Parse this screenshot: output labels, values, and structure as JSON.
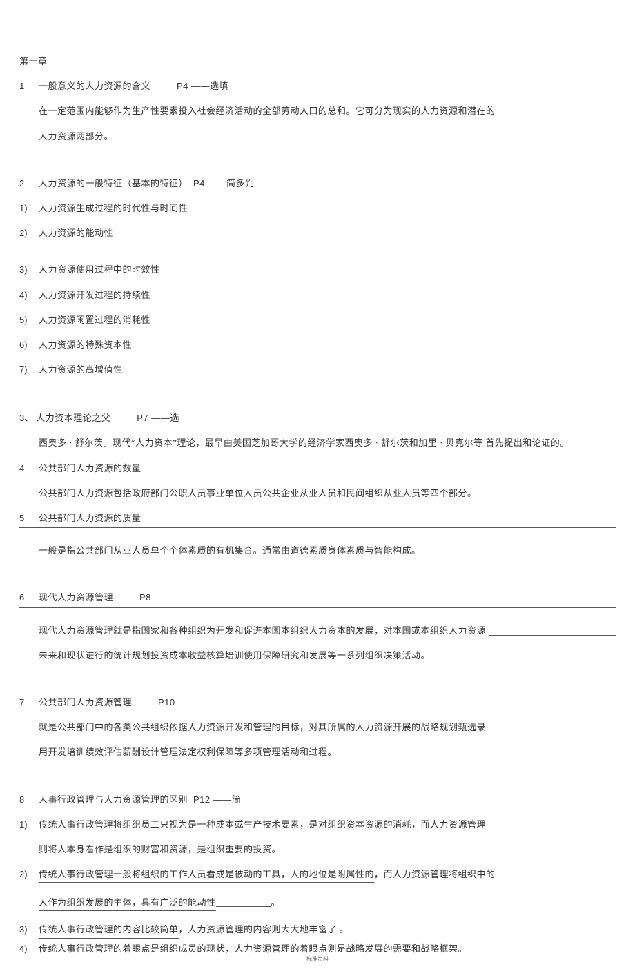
{
  "chapter": "第一章",
  "items": {
    "i1": {
      "num": "1",
      "title_a": "一般意义的人力资源的含义",
      "title_b": "P4 ——选填",
      "body_a": "在一定范围内能够作为生产性要素投入社会经济活动的全部劳动人口的总和。它可分为现实的人力资源和潜在的",
      "body_b": "人力资源两部分。"
    },
    "i2": {
      "num": "2",
      "title_a": "人力资源的一般特征（基本的特征）",
      "title_b": "P4 ——简多判",
      "list": {
        "n1": "1)",
        "t1": "人力资源生成过程的时代性与时间性",
        "n2": "2)",
        "t2": "人力资源的能动性",
        "n3": "3)",
        "t3": "人力资源使用过程中的时效性",
        "n4": "4)",
        "t4": "人力资源开发过程的持续性",
        "n5": "5)",
        "t5": "人力资源闲置过程的消耗性",
        "n6": "6)",
        "t6": "人力资源的特殊资本性",
        "n7": "7)",
        "t7": "人力资源的高增值性"
      }
    },
    "i3": {
      "num": "3、",
      "title_a": "人力资本理论之父",
      "title_b": "P7 ——选",
      "body": "西奥多 · 舒尔茨。现代“人力资本”理论，最早由美国芝加哥大学的经济学家西奥多 · 舒尔茨和加里 · 贝克尔等  首先提出和论证的。"
    },
    "i4": {
      "num": "4",
      "title": "公共部门人力资源的数量",
      "body": "公共部门人力资源包括政府部门公职人员事业单位人员公共企业从业人员和民间组织从业人员等四个部分。"
    },
    "i5": {
      "num": "5",
      "title": "公共部门人力资源的质量",
      "body": "一般是指公共部门从业人员单个个体素质的有机集合。通常由道德素质身体素质与智能构成。"
    },
    "i6": {
      "num": "6",
      "title_a": "现代人力资源管理",
      "title_b": "P8",
      "body_a": "现代人力资源管理就是指国家和各种组织为开发和促进本国本组织人力资本的发展，对本国或本组织人力资源",
      "body_b": "未来和现状进行的统计规划投资成本收益核算培训使用保障研究和发展等一系列组织决策活动。"
    },
    "i7": {
      "num": "7",
      "title_a": "公共部门人力资源管理",
      "title_b": "P10",
      "body_a": "就是公共部门中的各类公共组织依据人力资源开发和管理的目标，对其所属的人力资源开展的战略规划甄选录",
      "body_b": "用开发培训绩效评估薪酬设计管理法定权利保障等多项管理活动和过程。"
    },
    "i8": {
      "num": "8",
      "title_a": "人事行政管理与人力资源管理的区别",
      "title_b": "P12 ——简",
      "list": {
        "n1": "1)",
        "t1a": "传统人事行政管理将组织员工只视为是一种成本或生产技术要素，是对组织资本资源的消耗，而人力资源管理",
        "t1b": "则将人本身看作是组织的财富和资源，是组织重要的投资。",
        "n2": "2)",
        "t2a_pre": "传统人事行政管理一般将组织的工作人员看成是被动的工具，人的地位是附属性的",
        "t2a_post": "，而人力资源管理将组织中的",
        "t2b_pre": "人作为组织发展的主体，具有广泛的能动性",
        "t2b_post": "。",
        "n3": "3)",
        "t3_pre": "传统人事行政管理的内容比较简单",
        "t3_post": "，人力资源管理的内容则大大地丰富了 。",
        "n4": "4)",
        "t4_pre": "传统人事行政管理的着眼点是组织成员的现状",
        "t4_post": "，人力资源管理的着眼点则是战略发展的需要和战略框架。"
      }
    }
  },
  "footer": "标准资料"
}
